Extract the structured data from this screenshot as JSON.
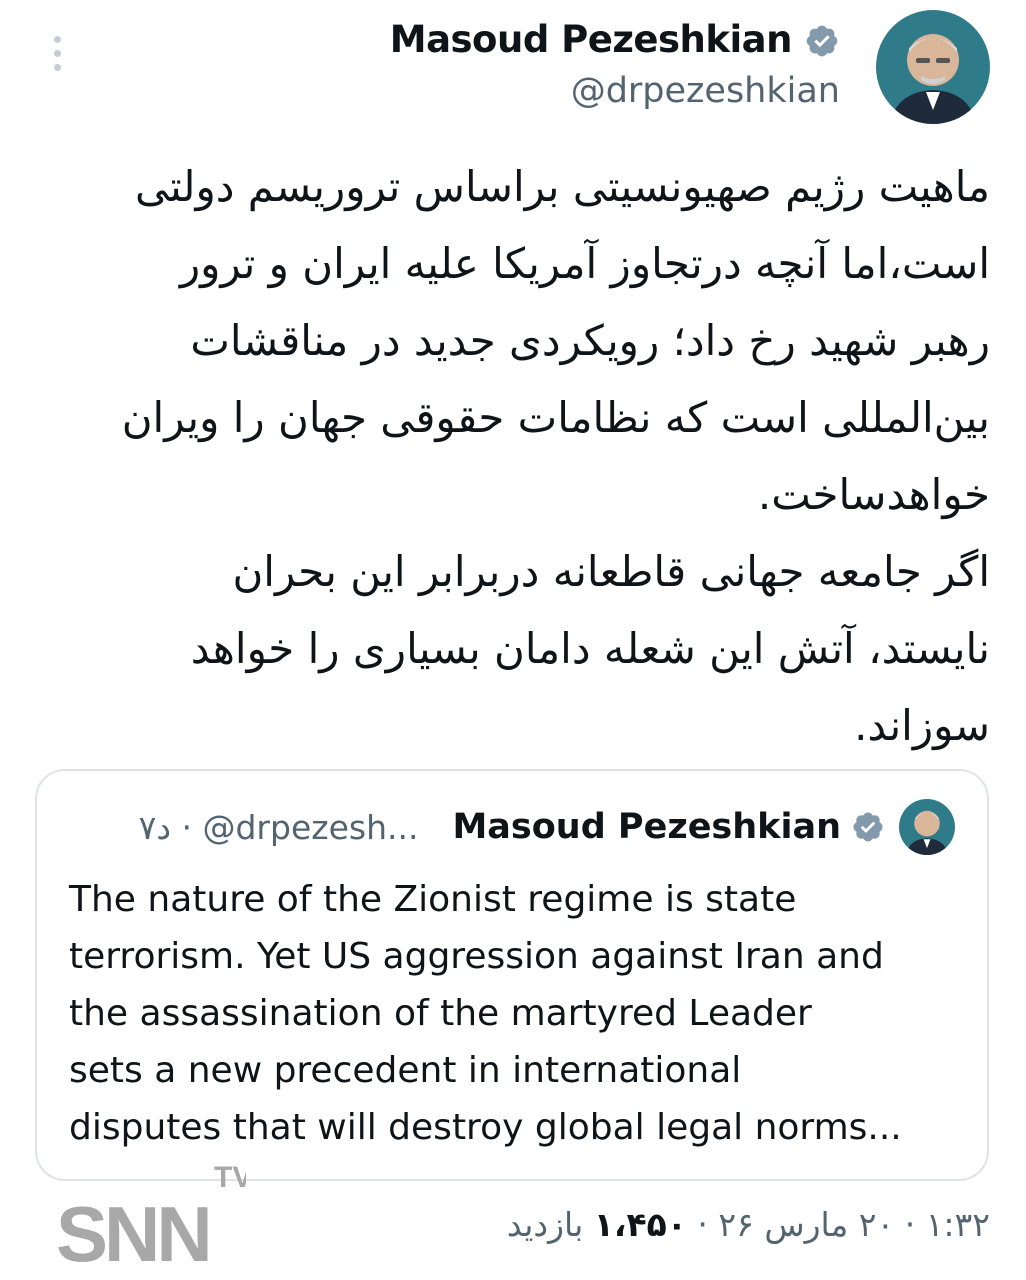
{
  "author": {
    "display_name": "Masoud Pezeshkian",
    "handle": "@drpezeshkian",
    "verified": true,
    "verified_color": "#829aab"
  },
  "tweet": {
    "text_lines": [
      "ماهیت رژیم صهیونسیتی براساس تروریسم دولتی",
      "است،اما آنچه درتجاوز آمریکا علیه ایران و ترور",
      "رهبر شهید رخ داد؛ رویکردی جدید در مناقشات",
      "بین‌المللی است که نظامات حقوقی جهان را ویران",
      "خواهدساخت.",
      "اگر جامعه جهانی قاطعانه دربرابر این بحران",
      "نایستد، آتش این شعله دامان بسیاری را خواهد",
      "سوزاند."
    ]
  },
  "quoted_tweet": {
    "display_name": "Masoud Pezeshkian",
    "meta": "۷د · @drpezesh...",
    "text_lines": [
      "The nature of the Zionist regime is state",
      "terrorism. Yet US aggression against Iran and",
      "the assassination of the martyred Leader",
      "sets a new precedent in international",
      "disputes that will destroy global legal norms..."
    ]
  },
  "footer": {
    "timestamp": "۱:۳۲ · ۲۰ مارس ۲۶ ·",
    "views_count": "۱،۴۵۰",
    "views_label": "بازدید"
  },
  "watermark": {
    "brand": "SNN",
    "suffix": "TV"
  },
  "icons": {
    "more": "more-vertical-icon",
    "verified": "verified-badge-icon"
  },
  "colors": {
    "text_primary": "#0f1419",
    "text_secondary": "#536471",
    "border": "#dfe3e7",
    "avatar_bg": "#2f7b8a"
  }
}
